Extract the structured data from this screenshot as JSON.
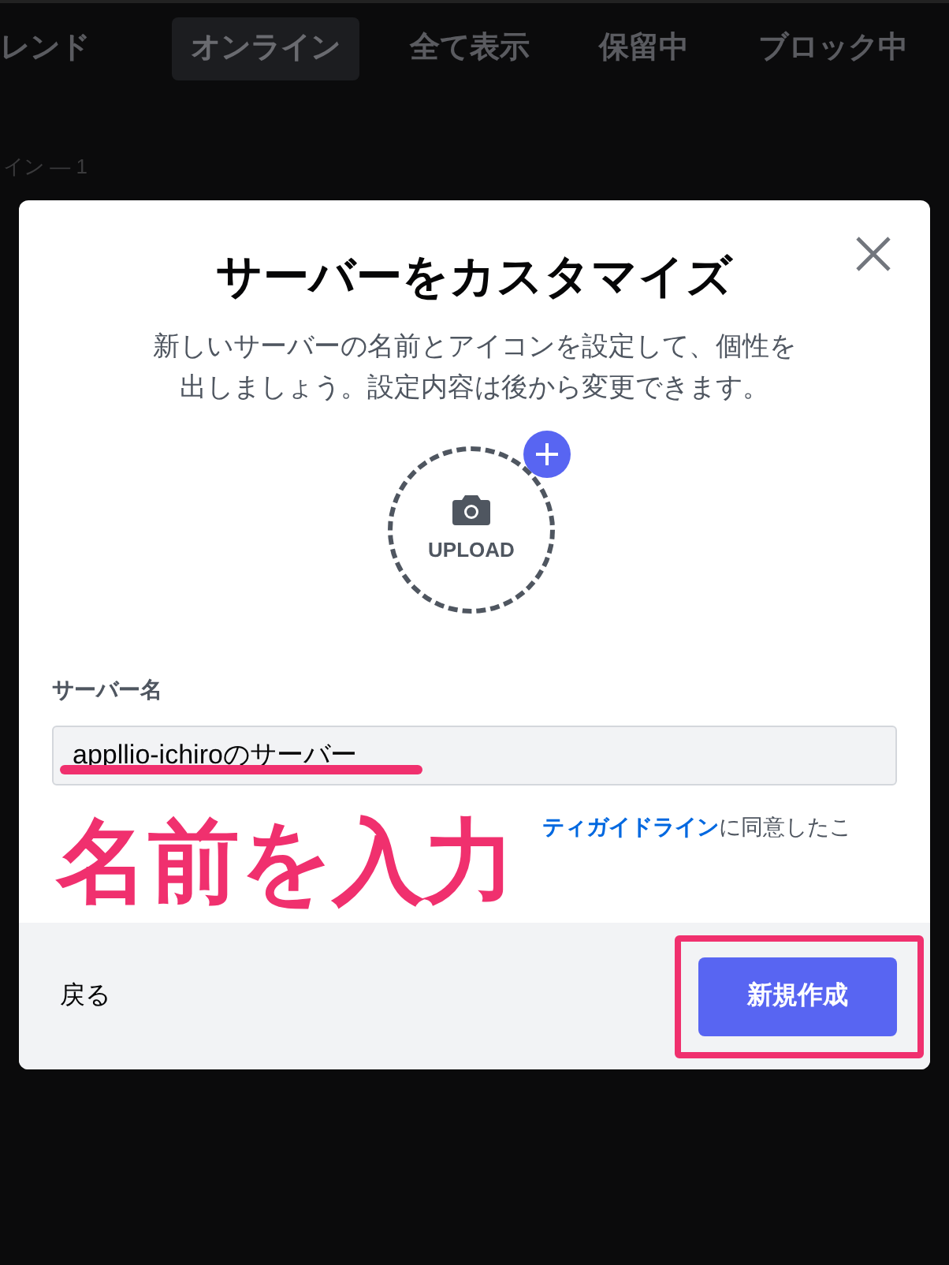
{
  "tabs": [
    {
      "label": "レンド",
      "selected": false
    },
    {
      "label": "オンライン",
      "selected": true
    },
    {
      "label": "全て表示",
      "selected": false
    },
    {
      "label": "保留中",
      "selected": false
    },
    {
      "label": "ブロック中",
      "selected": false
    }
  ],
  "section_header": "イン — 1",
  "modal": {
    "title": "サーバーをカスタマイズ",
    "description": "新しいサーバーの名前とアイコンを設定して、個性を出しましょう。設定内容は後から変更できます。",
    "upload_label": "UPLOAD",
    "field_label": "サーバー名",
    "server_name": "appllio-ichiroのサーバー",
    "terms": [
      {
        "kind": "link",
        "text": "ティガイドライン"
      },
      {
        "kind": "text",
        "text": "に同意したこ"
      }
    ],
    "back_button": "戻る",
    "create_button": "新規作成"
  },
  "annotation": {
    "caption": "名前を入力"
  }
}
